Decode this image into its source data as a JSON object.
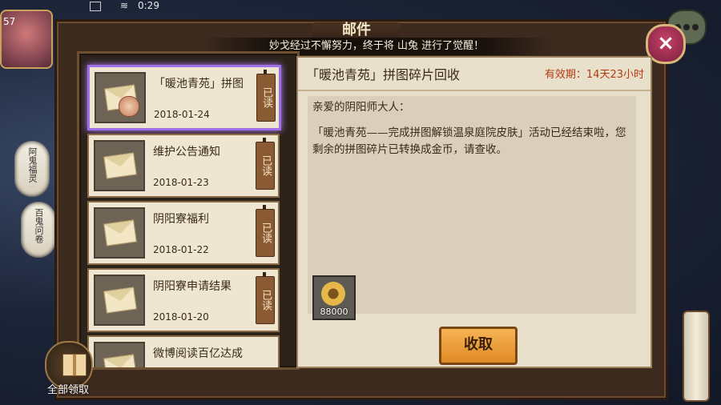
{
  "status_bar": {
    "time": "0:29",
    "level": "57"
  },
  "window": {
    "title": "邮件",
    "notice": "妙戈经过不懈努力，终于将 山兔 进行了觉醒！"
  },
  "close_icon": "×",
  "mail_list": [
    {
      "title": "「暖池青苑」拼图",
      "date": "2018-01-24",
      "read_label": "已读",
      "active": true
    },
    {
      "title": "维护公告通知",
      "date": "2018-01-23",
      "read_label": "已读",
      "active": false
    },
    {
      "title": "阴阳寮福利",
      "date": "2018-01-22",
      "read_label": "已读",
      "active": false
    },
    {
      "title": "阴阳寮申请结果",
      "date": "2018-01-20",
      "read_label": "已读",
      "active": false
    },
    {
      "title": "微博阅读百亿达成",
      "date": "",
      "read_label": "",
      "active": false
    }
  ],
  "detail": {
    "subject": "「暖池青苑」拼图碎片回收",
    "validity": "有效期：14天23小时",
    "greeting": "亲爱的阴阳师大人：",
    "body": "「暖池青苑——完成拼图解锁温泉庭院皮肤」活动已经结束啦，您剩余的拼图碎片已转换成金币，请查收。",
    "reward": {
      "icon": "coin-icon",
      "value": "88000"
    },
    "collect_label": "收取"
  },
  "collect_all_label": "全部领取",
  "lanterns": [
    "阿鬼福灵",
    "百鬼问卷"
  ],
  "colors": {
    "accent": "#e08a24",
    "validity": "#b33a12",
    "active_border": "#a070e8"
  }
}
